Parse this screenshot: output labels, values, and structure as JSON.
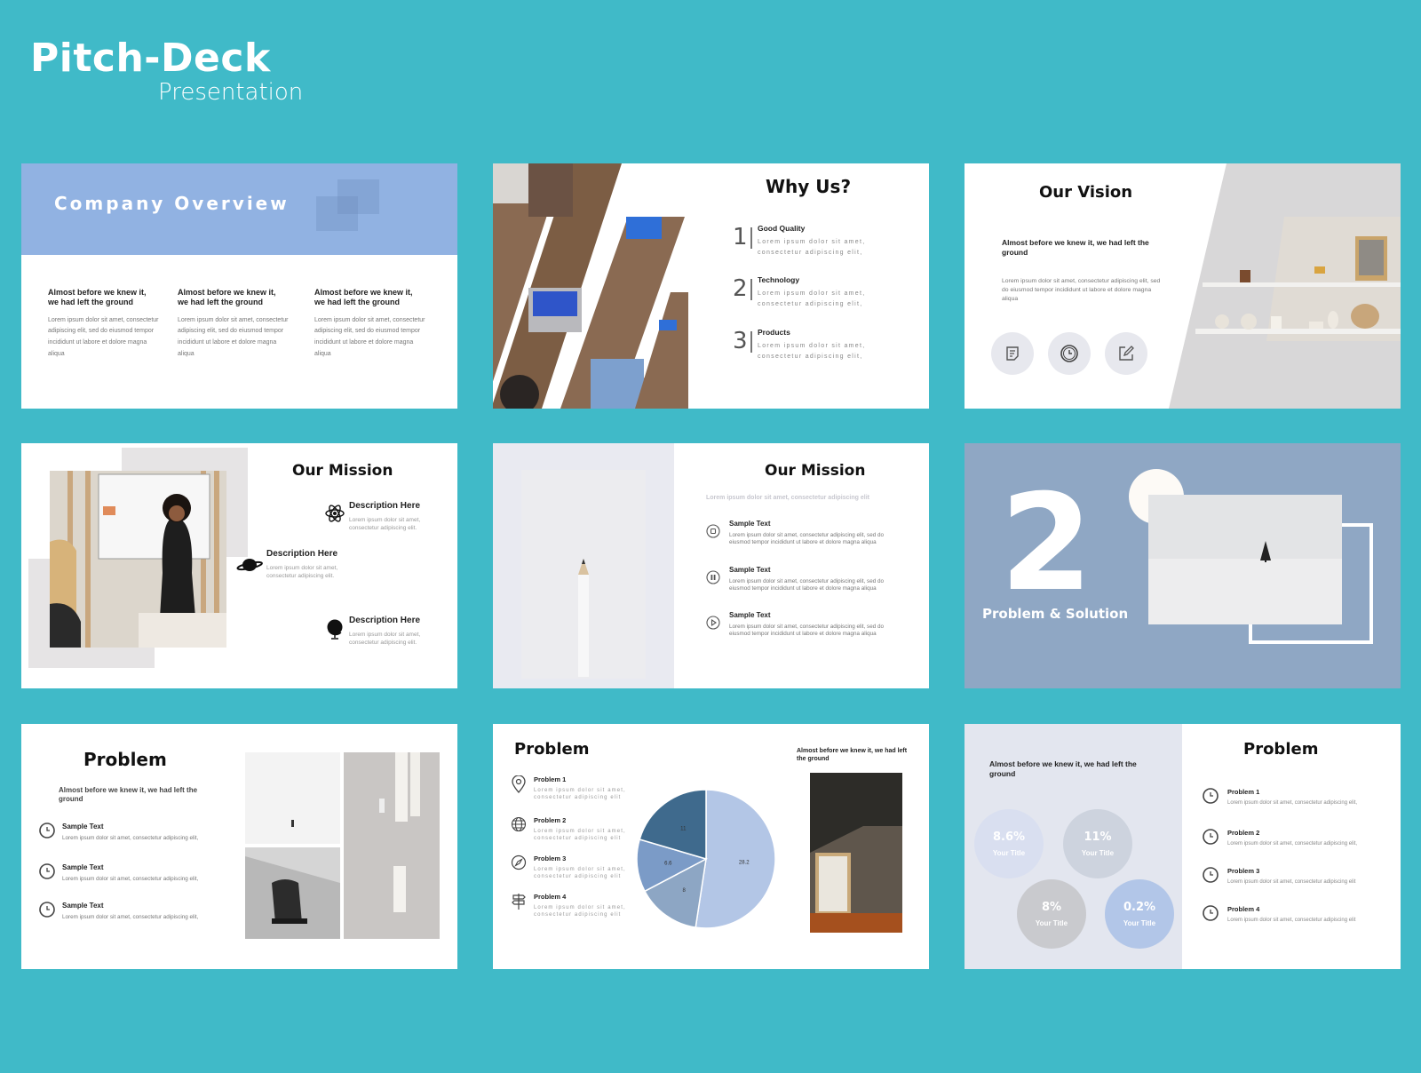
{
  "header": {
    "title": "Pitch-Deck",
    "subtitle": "Presentation"
  },
  "colors": {
    "background": "#40BAC8",
    "slide_accent_blue": "#91B2E2",
    "slate_blue": "#8FA7C4",
    "panel_gray": "#E3E6EF"
  },
  "lorem": {
    "short": "Lorem ipsum dolor sit amet, consectetur adipiscing elit,",
    "short_nocomma": "Lorem ipsum dolor sit amet, consectetur adipiscing elit",
    "long": "Lorem ipsum dolor sit amet, consectetur adipiscing elit, sed do eiusmod tempor incididunt ut labore et dolore magna aliqua",
    "desc": "Lorem ipsum dolor sit amet, consectetur adipiscing elit.",
    "tag": "Lorem ipsum dolor sit amet, consectetur adipiscing elit"
  },
  "slides": {
    "company_overview": {
      "title": "Company Overview",
      "columns": [
        {
          "heading": "Almost before we knew it, we had left the ground",
          "body": "Lorem ipsum dolor sit amet, consectetur adipiscing elit, sed do eiusmod tempor incididunt ut labore et dolore magna aliqua"
        },
        {
          "heading": "Almost before we knew it, we had left the ground",
          "body": "Lorem ipsum dolor sit amet, consectetur adipiscing elit, sed do eiusmod tempor incididunt ut labore et dolore magna aliqua"
        },
        {
          "heading": "Almost before we knew it, we had left the ground",
          "body": "Lorem ipsum dolor sit amet, consectetur adipiscing elit, sed do eiusmod tempor incididunt ut labore et dolore magna aliqua"
        }
      ]
    },
    "why_us": {
      "title": "Why Us?",
      "items": [
        {
          "num": "1",
          "label": "Good Quality",
          "body": "Lorem ipsum dolor sit amet, consectetur adipiscing elit,"
        },
        {
          "num": "2",
          "label": "Technology",
          "body": "Lorem ipsum dolor sit amet, consectetur adipiscing elit,"
        },
        {
          "num": "3",
          "label": "Products",
          "body": "Lorem ipsum dolor sit amet, consectetur adipiscing elit,"
        }
      ]
    },
    "our_vision": {
      "title": "Our Vision",
      "subtitle": "Almost before we knew it, we had left the ground",
      "body": "Lorem ipsum dolor sit amet, consectetur adipiscing elit, sed do eiusmod tempor incididunt ut labore et dolore magna aliqua",
      "icons": [
        "note-icon",
        "clock-icon",
        "edit-icon"
      ]
    },
    "our_mission_a": {
      "title": "Our Mission",
      "items": [
        {
          "icon": "atom-icon",
          "heading": "Description Here",
          "body": "Lorem ipsum dolor sit amet, consectetur adipiscing elit."
        },
        {
          "icon": "planet-icon",
          "heading": "Description Here",
          "body": "Lorem ipsum dolor sit amet, consectetur adipiscing elit."
        },
        {
          "icon": "globe-icon",
          "heading": "Description Here",
          "body": "Lorem ipsum dolor sit amet, consectetur adipiscing elit."
        }
      ]
    },
    "our_mission_b": {
      "title": "Our Mission",
      "tagline": "Lorem ipsum dolor sit amet, consectetur adipiscing elit",
      "items": [
        {
          "icon": "stop-icon",
          "heading": "Sample Text",
          "body": "Lorem ipsum dolor sit amet, consectetur adipiscing elit, sed do eiusmod tempor incididunt ut labore et dolore magna aliqua"
        },
        {
          "icon": "pause-icon",
          "heading": "Sample Text",
          "body": "Lorem ipsum dolor sit amet, consectetur adipiscing elit, sed do eiusmod tempor incididunt ut labore et dolore magna aliqua"
        },
        {
          "icon": "play-icon",
          "heading": "Sample Text",
          "body": "Lorem ipsum dolor sit amet, consectetur adipiscing elit, sed do eiusmod tempor incididunt ut labore et dolore magna aliqua"
        }
      ]
    },
    "section_divider": {
      "number": "2",
      "label": "Problem & Solution"
    },
    "problem_a": {
      "title": "Problem",
      "subtitle": "Almost before we knew it, we had left the ground",
      "items": [
        {
          "heading": "Sample Text",
          "body": "Lorem ipsum dolor sit amet, consectetur adipiscing elit,"
        },
        {
          "heading": "Sample Text",
          "body": "Lorem ipsum dolor sit amet, consectetur adipiscing elit,"
        },
        {
          "heading": "Sample Text",
          "body": "Lorem ipsum dolor sit amet, consectetur adipiscing elit,"
        }
      ]
    },
    "problem_b": {
      "title": "Problem",
      "caption": "Almost before we knew it, we had left the ground",
      "items": [
        {
          "icon": "map-pin-icon",
          "heading": "Problem 1",
          "body": "Lorem ipsum dolor sit amet, consectetur adipiscing elit"
        },
        {
          "icon": "globe-grid-icon",
          "heading": "Problem 2",
          "body": "Lorem ipsum dolor sit amet, consectetur adipiscing elit"
        },
        {
          "icon": "compass-icon",
          "heading": "Problem 3",
          "body": "Lorem ipsum dolor sit amet, consectetur adipiscing elit"
        },
        {
          "icon": "signpost-icon",
          "heading": "Problem 4",
          "body": "Lorem ipsum dolor sit amet, consectetur adipiscing elit"
        }
      ]
    },
    "problem_c": {
      "title": "Problem",
      "subtitle": "Almost before we knew it, we had left the ground",
      "stats": [
        {
          "value": "8.6%",
          "label": "Your Title",
          "color": "#D9DFF0"
        },
        {
          "value": "11%",
          "label": "Your Title",
          "color": "#CDD3DE"
        },
        {
          "value": "8%",
          "label": "Your Title",
          "color": "#C9CACE"
        },
        {
          "value": "0.2%",
          "label": "Your Title",
          "color": "#B2C6E8"
        }
      ],
      "items": [
        {
          "heading": "Problem 1",
          "body": "Lorem ipsum dolor sit amet, consectetur adipiscing elit,"
        },
        {
          "heading": "Problem 2",
          "body": "Lorem ipsum dolor sit amet, consectetur adipiscing elit,"
        },
        {
          "heading": "Problem 3",
          "body": "Lorem ipsum dolor sit amet, consectetur adipiscing elit"
        },
        {
          "heading": "Problem 4",
          "body": "Lorem ipsum dolor sit amet, consectetur adipiscing elit"
        }
      ]
    }
  },
  "chart_data": {
    "type": "pie",
    "title": "",
    "slices": [
      {
        "label": "28.2",
        "value": 28.2,
        "color": "#B3C6E6"
      },
      {
        "label": "8",
        "value": 8,
        "color": "#8DA6C4"
      },
      {
        "label": "6.6",
        "value": 6.6,
        "color": "#7B9BC7"
      },
      {
        "label": "11",
        "value": 11,
        "color": "#3F6A8D"
      }
    ],
    "start": "12 o'clock",
    "direction": "clockwise",
    "legend": "none"
  }
}
